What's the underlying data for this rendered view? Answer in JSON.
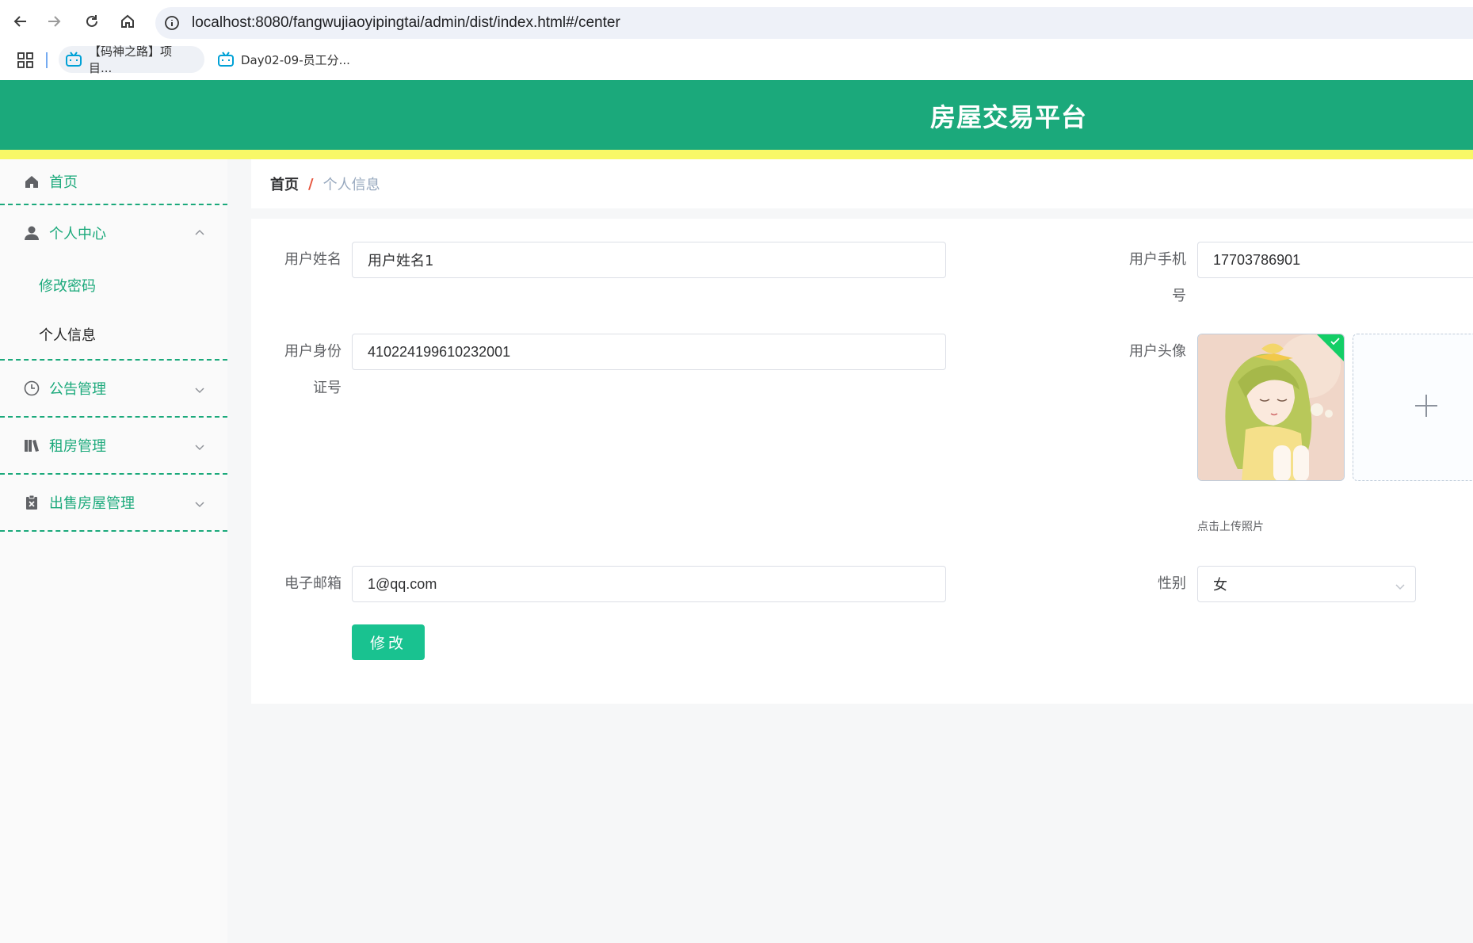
{
  "browser": {
    "url": "localhost:8080/fangwujiaoyipingtai/admin/dist/index.html#/center",
    "bookmarks": [
      {
        "label": "【码神之路】项目..."
      },
      {
        "label": "Day02-09-员工分..."
      }
    ]
  },
  "header": {
    "title": "房屋交易平台"
  },
  "sidebar": {
    "home": "首页",
    "personal_center": "个人中心",
    "sub_items": [
      "修改密码",
      "个人信息"
    ],
    "notice_mgmt": "公告管理",
    "rent_mgmt": "租房管理",
    "sale_mgmt": "出售房屋管理"
  },
  "breadcrumb": {
    "home": "首页",
    "separator": "/",
    "current": "个人信息"
  },
  "form": {
    "username_label": "用户姓名",
    "username_value": "用户姓名1",
    "phone_label_line1": "用户手机",
    "phone_label_line2": "号",
    "phone_value": "17703786901",
    "idcard_label_line1": "用户身份",
    "idcard_label_line2": "证号",
    "idcard_value": "410224199610232001",
    "avatar_label": "用户头像",
    "upload_hint": "点击上传照片",
    "email_label": "电子邮箱",
    "email_value": "1@qq.com",
    "gender_label": "性别",
    "gender_value": "女",
    "submit_label": "修改"
  },
  "colors": {
    "header_green": "#1ba97b",
    "accent_yellow": "#f8f867",
    "button_green": "#19c290"
  }
}
